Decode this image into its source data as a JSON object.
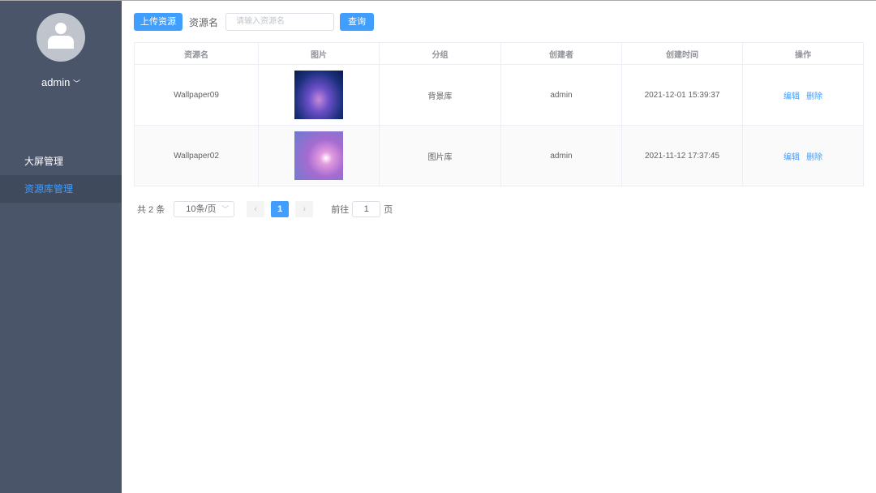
{
  "sidebar": {
    "username": "admin",
    "menu": [
      {
        "label": "大屏管理"
      },
      {
        "label": "资源库管理"
      }
    ]
  },
  "toolbar": {
    "upload": "上传资源",
    "name_label": "资源名",
    "placeholder": "请输入资源名",
    "search": "查询"
  },
  "table": {
    "headers": [
      "资源名",
      "图片",
      "分组",
      "创建者",
      "创建时间",
      "操作"
    ],
    "rows": [
      {
        "name": "Wallpaper09",
        "group": "背景库",
        "creator": "admin",
        "time": "2021-12-01 15:39:37",
        "edit": "编辑",
        "del": "删除"
      },
      {
        "name": "Wallpaper02",
        "group": "图片库",
        "creator": "admin",
        "time": "2021-11-12 17:37:45",
        "edit": "编辑",
        "del": "删除"
      }
    ]
  },
  "pager": {
    "total": "共 2 条",
    "size": "10条/页",
    "page": "1",
    "goto": "前往",
    "goto_value": "1",
    "page_unit": "页"
  }
}
